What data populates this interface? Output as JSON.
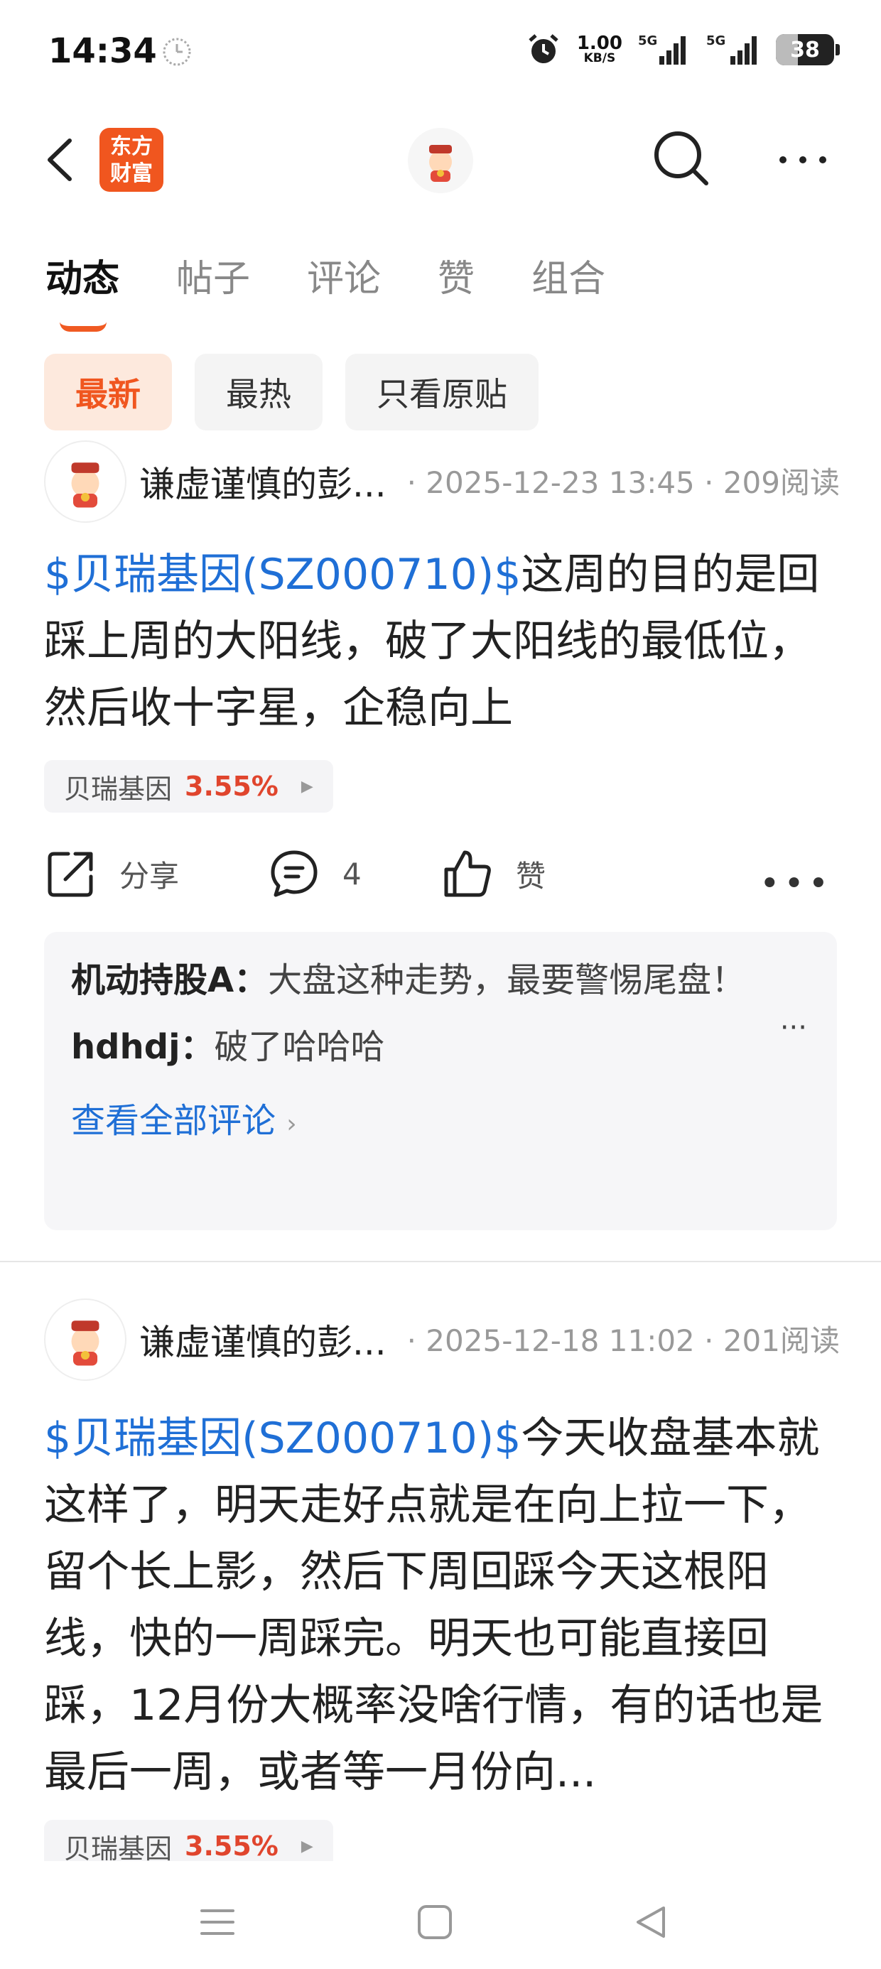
{
  "status": {
    "time": "14:34",
    "speed_value": "1.00",
    "speed_unit": "KB/S",
    "signal1": "5G",
    "signal2": "5G",
    "battery": "38",
    "battery_level": 0.38
  },
  "header": {
    "logo_text_line1": "东方",
    "logo_text_line2": "财富"
  },
  "tabs": [
    "动态",
    "帖子",
    "评论",
    "赞",
    "组合"
  ],
  "filters": [
    "最新",
    "最热",
    "只看原贴"
  ],
  "posts": [
    {
      "author": "谦虚谨慎的彭...",
      "meta": "· 2025-12-23 13:45 · 209阅读",
      "tag": "$贝瑞基因(SZ000710)$",
      "text": "这周的目的是回踩上周的大阳线，破了大阳线的最低位，然后收十字星，企稳向上",
      "stock_name": "贝瑞基因",
      "stock_pct": "3.55%",
      "share_label": "分享",
      "comment_count": "4",
      "like_label": "赞",
      "comments": [
        {
          "user": "机动持股A：",
          "text": "大盘这种走势，最要警惕尾盘！"
        },
        {
          "user": "hdhdj：",
          "text": "破了哈哈哈"
        }
      ],
      "view_all": "查看全部评论"
    },
    {
      "author": "谦虚谨慎的彭...",
      "meta": "· 2025-12-18 11:02 · 201阅读",
      "tag": "$贝瑞基因(SZ000710)$",
      "text": "今天收盘基本就这样了，明天走好点就是在向上拉一下，留个长上影，然后下周回踩今天这根阳线，快的一周踩完。明天也可能直接回踩，12月份大概率没啥行情，有的话也是最后一周，或者等一月份向...",
      "stock_name": "贝瑞基因",
      "stock_pct": "3.55%"
    }
  ]
}
